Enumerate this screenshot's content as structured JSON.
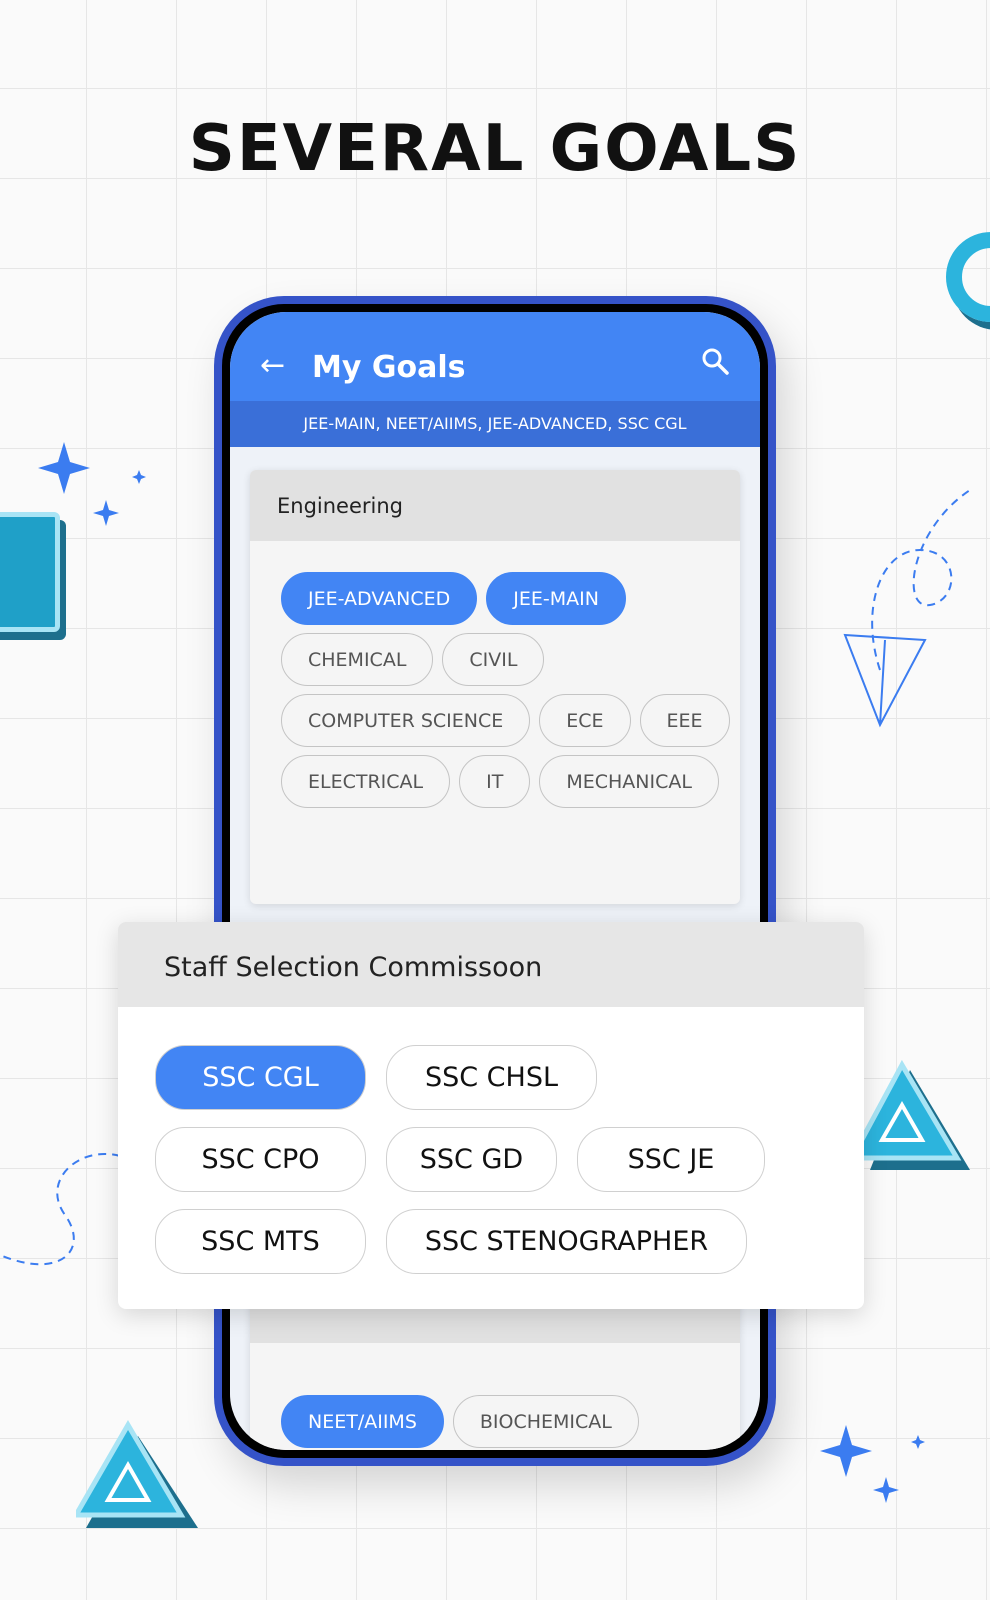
{
  "headline": "SEVERAL GOALS",
  "app": {
    "title": "My Goals",
    "selected_goals": "JEE-MAIN, NEET/AIIMS, JEE-ADVANCED, SSC CGL",
    "back_icon": "arrow-left-icon",
    "search_icon": "search-icon",
    "accent": "#4285f4"
  },
  "engineering": {
    "title": "Engineering",
    "chips": [
      {
        "label": "JEE-ADVANCED",
        "selected": true
      },
      {
        "label": "JEE-MAIN",
        "selected": true
      },
      {
        "label": "CHEMICAL",
        "selected": false
      },
      {
        "label": "CIVIL",
        "selected": false
      },
      {
        "label": "COMPUTER SCIENCE",
        "selected": false
      },
      {
        "label": "ECE",
        "selected": false
      },
      {
        "label": "EEE",
        "selected": false
      },
      {
        "label": "ELECTRICAL",
        "selected": false
      },
      {
        "label": "IT",
        "selected": false
      },
      {
        "label": "MECHANICAL",
        "selected": false
      }
    ]
  },
  "ssc": {
    "title": "Staff Selection Commissoon",
    "chips": [
      {
        "label": "SSC CGL",
        "selected": true
      },
      {
        "label": "SSC CHSL",
        "selected": false
      },
      {
        "label": "SSC CPO",
        "selected": false
      },
      {
        "label": "SSC GD",
        "selected": false
      },
      {
        "label": "SSC JE",
        "selected": false
      },
      {
        "label": "SSC MTS",
        "selected": false
      },
      {
        "label": "SSC STENOGRAPHER",
        "selected": false
      }
    ]
  },
  "medical": {
    "chips": [
      {
        "label": "NEET/AIIMS",
        "selected": true
      },
      {
        "label": "BIOCHEMICAL",
        "selected": false
      }
    ]
  }
}
